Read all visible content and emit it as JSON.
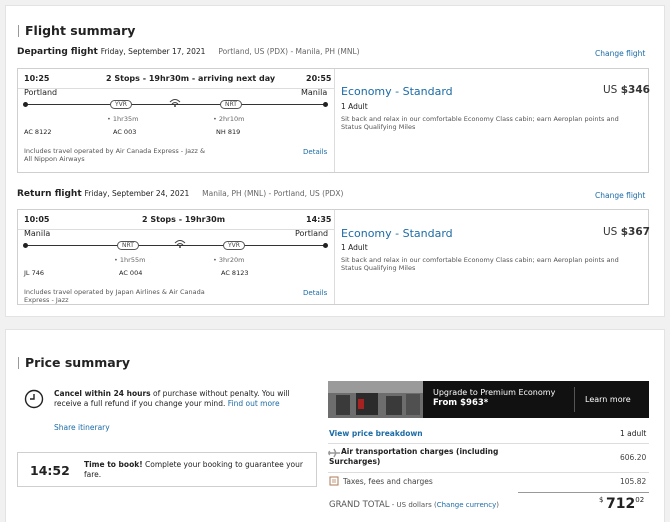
{
  "flight_summary": {
    "title": "Flight summary",
    "departing": {
      "heading": "Departing flight",
      "date": "Friday, September 17, 2021",
      "route": "Portland, US (PDX) - Manila, PH (MNL)",
      "change_label": "Change flight",
      "dep_time": "10:25",
      "arr_time": "20:55",
      "stops_label": "2 Stops - 19hr30m - arriving next day",
      "origin_city": "Portland",
      "dest_city": "Manila",
      "stop1_code": "YVR",
      "stop2_code": "NRT",
      "layover1": "• 1hr35m",
      "layover2": "• 2hr10m",
      "flight1": "AC 8122",
      "flight2": "AC 003",
      "flight3": "NH 819",
      "operated": "Includes travel operated by Air Canada Express - Jazz & All Nippon Airways",
      "details_label": "Details",
      "fare": "Economy - Standard",
      "passengers": "1 Adult",
      "fare_desc": "Sit back and relax in our comfortable Economy Class cabin; earn Aeroplan points and Status Qualifying Miles",
      "price_currency": "US",
      "price_amount": "$346"
    },
    "return": {
      "heading": "Return flight",
      "date": "Friday, September 24, 2021",
      "route": "Manila, PH (MNL) - Portland, US (PDX)",
      "change_label": "Change flight",
      "dep_time": "10:05",
      "arr_time": "14:35",
      "stops_label": "2 Stops - 19hr30m",
      "origin_city": "Manila",
      "dest_city": "Portland",
      "stop1_code": "NRT",
      "stop2_code": "YVR",
      "layover1": "• 1hr55m",
      "layover2": "• 3hr20m",
      "flight1": "JL 746",
      "flight2": "AC 004",
      "flight3": "AC 8123",
      "operated": "Includes travel operated by Japan Airlines & Air Canada Express - Jazz",
      "details_label": "Details",
      "fare": "Economy - Standard",
      "passengers": "1 Adult",
      "fare_desc": "Sit back and relax in our comfortable Economy Class cabin; earn Aeroplan points and Status Qualifying Miles",
      "price_currency": "US",
      "price_amount": "$367"
    }
  },
  "price_summary": {
    "title": "Price summary",
    "cancel_bold": "Cancel within 24 hours",
    "cancel_text": " of purchase without penalty. You will receive a full refund if you change your mind.",
    "find_out_more": "Find out more",
    "share": "Share itinerary",
    "timer": "14:52",
    "timer_bold": "Time to book!",
    "timer_text": " Complete your booking to guarantee your fare.",
    "upgrade_line1": "Upgrade to Premium Economy",
    "upgrade_line2": "From $963*",
    "learn_more": "Learn more",
    "breakdown_label": "View price breakdown",
    "adult_label": "1 adult",
    "air_charges": "Air transportation charges (including Surcharges)",
    "air_amount": "606.20",
    "taxes_label": "Taxes, fees and charges",
    "taxes_amount": "105.82",
    "grand_total_label": "GRAND TOTAL",
    "currency_note": " - US dollars (",
    "change_currency": "Change currency",
    "currency_close": ")",
    "total_symbol": "$",
    "total_int": "712",
    "total_dec": "02"
  },
  "colors": {
    "link": "#1b6ba6",
    "banner": "#111111"
  }
}
